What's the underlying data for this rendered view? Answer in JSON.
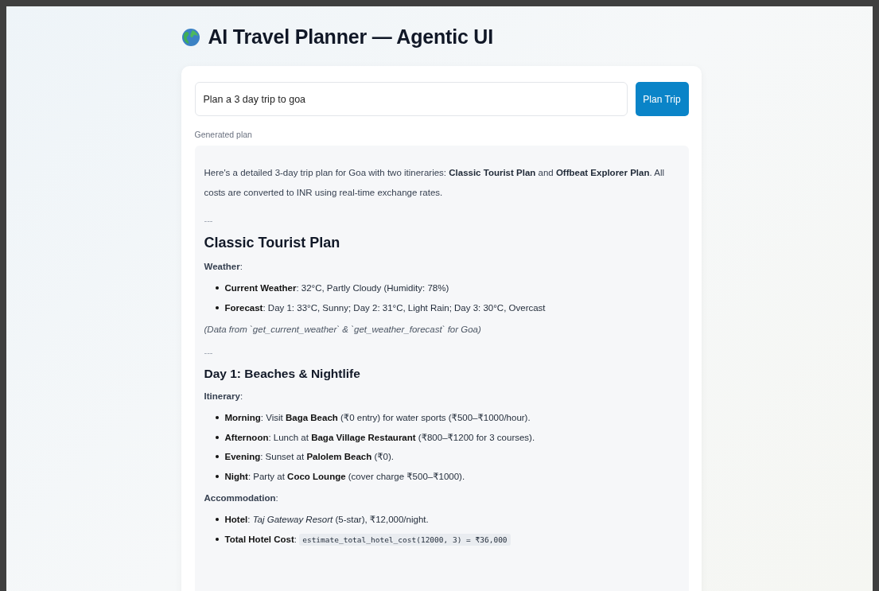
{
  "title": "AI Travel Planner — Agentic UI",
  "prompt": {
    "value": "Plan a 3 day trip to goa"
  },
  "plan_button": "Plan Trip",
  "output_label": "Generated plan",
  "blocks": [
    {
      "kind": "paragraph",
      "text": "Here's a detailed 3-day trip plan for Goa with two itineraries: **Classic Tourist Plan** and **Offbeat Explorer Plan**. All costs are converted to INR using real-time exchange rates."
    },
    {
      "kind": "rule",
      "text": "---"
    },
    {
      "kind": "h2",
      "text": "Classic Tourist Plan"
    },
    {
      "kind": "label",
      "text": "**Weather**:"
    },
    {
      "kind": "bullets",
      "items": [
        {
          "text": "**Current Weather**: 32°C, Partly Cloudy (Humidity: 78%)"
        },
        {
          "text": "**Forecast**: Day 1: 33°C, Sunny; Day 2: 31°C, Light Rain; Day 3: 30°C, Overcast"
        }
      ]
    },
    {
      "kind": "note",
      "text": "(Data from `get_current_weather` & `get_weather_forecast` for Goa)"
    },
    {
      "kind": "rule",
      "text": "---"
    },
    {
      "kind": "h3",
      "text": "Day 1: Beaches & Nightlife"
    },
    {
      "kind": "label",
      "text": "**Itinerary**:"
    },
    {
      "kind": "bullets",
      "items": [
        {
          "text": "**Morning**: Visit **Baga Beach** (₹0 entry) for water sports (₹500–₹1000/hour)."
        },
        {
          "text": "**Afternoon**: Lunch at **Baga Village Restaurant** (₹800–₹1200 for 3 courses)."
        },
        {
          "text": "**Evening**: Sunset at **Palolem Beach** (₹0)."
        },
        {
          "text": "**Night**: Party at **Coco Lounge** (cover charge ₹500–₹1000)."
        }
      ]
    },
    {
      "kind": "label",
      "text": "**Accommodation**:"
    },
    {
      "kind": "bullets",
      "items": [
        {
          "text": "**Hotel**: *Taj Gateway Resort* (5-star), ₹12,000/night."
        },
        {
          "text": "**Total Hotel Cost**: ",
          "code": "estimate_total_hotel_cost(12000, 3) = ₹36,000"
        }
      ]
    }
  ]
}
